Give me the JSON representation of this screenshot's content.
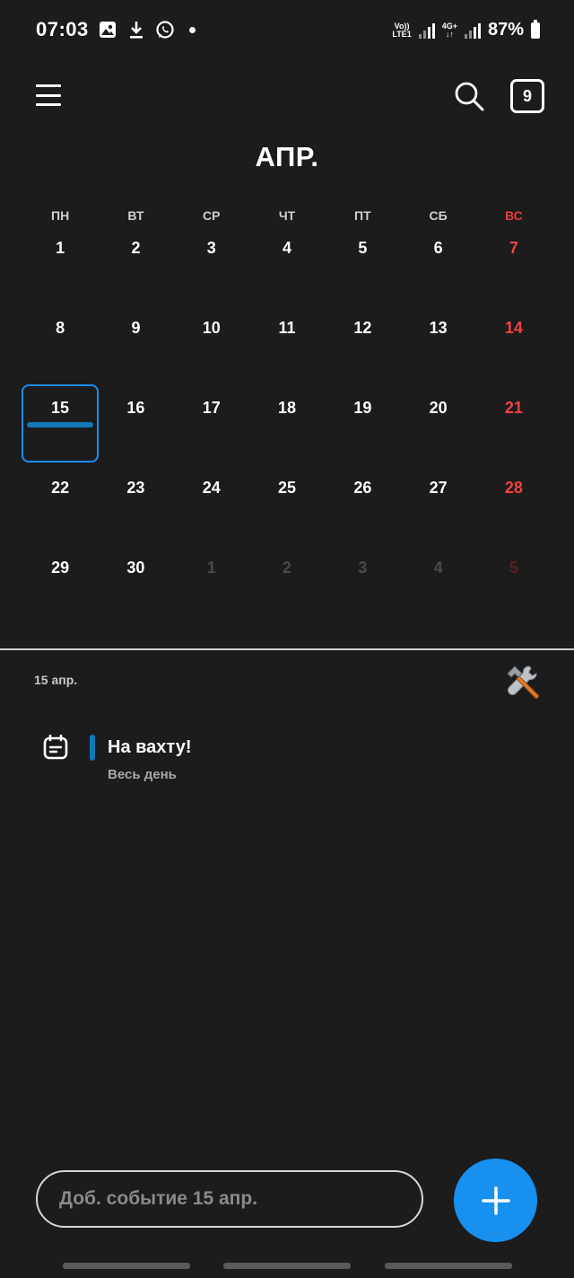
{
  "status_bar": {
    "time": "07:03",
    "volte_top": "Vo))",
    "volte_bottom": "LTE1",
    "net_top": "4G+",
    "net_bottom": "↓↑",
    "battery": "87%"
  },
  "header": {
    "today_number": "9",
    "month_title": "АПР."
  },
  "calendar": {
    "weekdays": [
      "ПН",
      "ВТ",
      "СР",
      "ЧТ",
      "ПТ",
      "СБ",
      "ВС"
    ],
    "weeks": [
      [
        "1",
        "2",
        "3",
        "4",
        "5",
        "6",
        "7"
      ],
      [
        "8",
        "9",
        "10",
        "11",
        "12",
        "13",
        "14"
      ],
      [
        "15",
        "16",
        "17",
        "18",
        "19",
        "20",
        "21"
      ],
      [
        "22",
        "23",
        "24",
        "25",
        "26",
        "27",
        "28"
      ],
      [
        "29",
        "30",
        "1",
        "2",
        "3",
        "4",
        "5"
      ]
    ],
    "selected_day": "15",
    "sunday_color": "#f0423f",
    "selection_color": "#1a8df0",
    "event_color": "#1378b8"
  },
  "day_view": {
    "date_label": "15 апр.",
    "events": [
      {
        "title": "На вахту!",
        "subtitle": "Весь день"
      }
    ]
  },
  "bottom": {
    "add_placeholder": "Доб. событие 15 апр.",
    "fab_color": "#1890f0"
  },
  "icons": {
    "menu": "menu-icon",
    "search": "search-icon",
    "tools": "hammer-wrench-icon",
    "event": "calendar-note-icon",
    "add": "plus-icon"
  }
}
